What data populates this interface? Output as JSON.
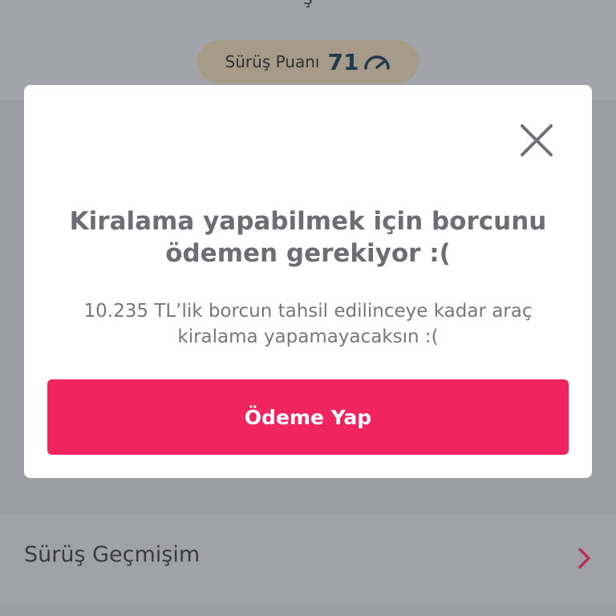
{
  "background": {
    "top_cutoff_text": "ş",
    "score_pill": {
      "label": "Sürüş Puanı",
      "value": "71",
      "icon": "gauge-icon"
    },
    "history_row": {
      "label": "Sürüş Geçmişim",
      "icon": "chevron-right-icon"
    }
  },
  "modal": {
    "close_icon": "close-icon",
    "title": "Kiralama yapabilmek için borcunu ödemen gerekiyor :(",
    "description": "10.235 TL’lik borcun tahsil edilinceye kadar araç kiralama yapamayacaksın :(",
    "pay_button_label": "Ödeme Yap"
  },
  "colors": {
    "accent": "#f0245f",
    "overlay": "#9c9ca3",
    "modal_background": "#ffffff",
    "title_text": "#6e6e72",
    "chevron": "#b23354"
  }
}
